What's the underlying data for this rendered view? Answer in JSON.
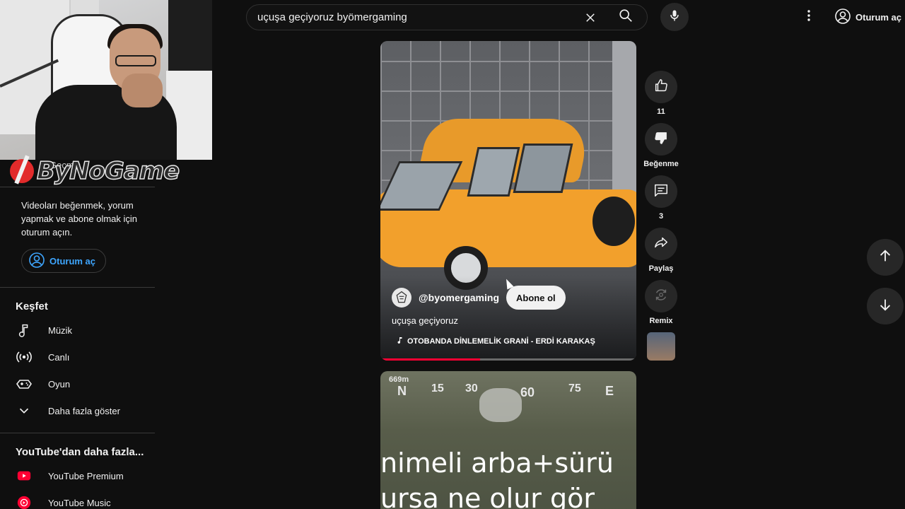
{
  "header": {
    "search_value": "uçuşa geçiyoruz byömergaming",
    "account_label": "Oturum aç"
  },
  "overlay": {
    "logo_text": "ByNoGame",
    "history_ghost": "Geçmiş"
  },
  "sidebar": {
    "signin_text": "Videoları beğenmek, yorum yapmak ve abone olmak için oturum açın.",
    "signin_button": "Oturum aç",
    "explore_title": "Keşfet",
    "explore_items": [
      {
        "label": "Müzik",
        "icon": "music-note-icon"
      },
      {
        "label": "Canlı",
        "icon": "live-icon"
      },
      {
        "label": "Oyun",
        "icon": "gaming-icon"
      },
      {
        "label": "Daha fazla göster",
        "icon": "chevron-down-icon"
      }
    ],
    "more_title": "YouTube'dan daha fazla...",
    "more_items": [
      {
        "label": "YouTube Premium",
        "icon": "youtube-premium-icon",
        "color": "#ff0033"
      },
      {
        "label": "YouTube Music",
        "icon": "youtube-music-icon",
        "color": "#ff0033"
      }
    ]
  },
  "short": {
    "channel": "@byomergaming",
    "subscribe_label": "Abone ol",
    "title": "uçuşa geçiyoruz",
    "music": "OTOBANDA DİNLEMELİK GRANİ - ERDİ KARAKAŞ",
    "progress": 0.39
  },
  "next_short": {
    "compass": [
      "669m",
      "N",
      "15",
      "30",
      "60",
      "75",
      "E"
    ],
    "line1": "nimeli arba+sürü",
    "line2": "ursa ne olur gör"
  },
  "actions": {
    "like_count": "11",
    "dislike_label": "Beğenme",
    "comment_count": "3",
    "share_label": "Paylaş",
    "remix_label": "Remix"
  },
  "colors": {
    "background": "#0f0f0f",
    "accent_blue": "#3ea6ff",
    "progress_red": "#ff0033"
  }
}
